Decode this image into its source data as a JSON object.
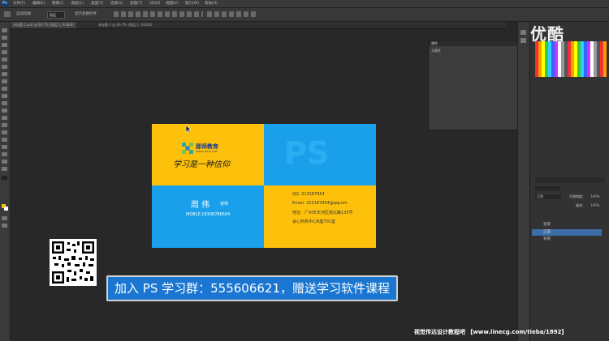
{
  "app": {
    "logo": "Ps"
  },
  "menubar": {
    "items": [
      "文件(F)",
      "编辑(E)",
      "图像(I)",
      "图层(L)",
      "类型(Y)",
      "选择(S)",
      "滤镜(T)",
      "3D(D)",
      "视图(V)",
      "窗口(W)",
      "帮助(H)"
    ]
  },
  "options": {
    "auto_select": "自动选择：",
    "target": "图层",
    "transform": "显示变换控件"
  },
  "tabs": [
    {
      "label": "未标题-1.psd @ 66.7% (图层 1, RGB/8)"
    },
    {
      "label": "未标题-2 @ 66.7% (图层 1, RGB/8)"
    }
  ],
  "card": {
    "company_name": "那师教育",
    "company_url": "www.nashi.com",
    "slogan": "学习是一种信仰",
    "ps_mark": "PS",
    "person_name": "周  伟",
    "person_title": "讲师",
    "mobile": "MOBLE:18308786584",
    "qq": "QQ:  313187954",
    "email": "Email:  313187954@qqcom",
    "address": "地址：广州市天河区南北路135号",
    "address2": "会心商务中心B座701室"
  },
  "banner": {
    "text": "加入 PS 学习群：555606621，赠送学习软件课程"
  },
  "watermark": {
    "text": "视觉传达设计教程吧 【www.linecg.com/tieba/1892】"
  },
  "overlay_logo": {
    "text": "优酷"
  },
  "panel": {
    "title": "属性",
    "subtitle": "无属性",
    "layers_mode": "正常",
    "opacity_label": "不透明度：",
    "opacity": "100%",
    "fill_label": "填充：",
    "fill": "100%",
    "layers": [
      "背景",
      "正面",
      "背景"
    ]
  }
}
